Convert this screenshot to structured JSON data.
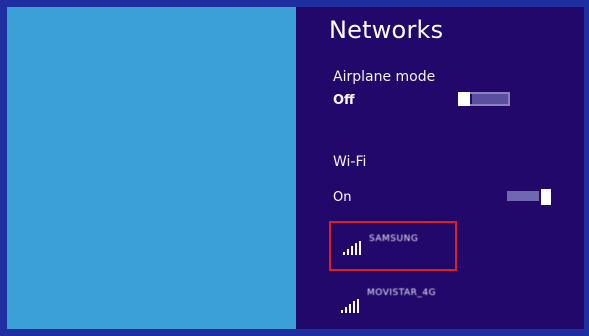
{
  "panel": {
    "title": "Networks",
    "airplane_mode": {
      "label": "Airplane mode",
      "state": "Off",
      "enabled": false
    },
    "wifi": {
      "label": "Wi-Fi",
      "state": "On",
      "enabled": true
    },
    "networks": [
      {
        "ssid": "SAMSUNG",
        "signal_bars": 5,
        "selected": true,
        "icon": "wifi-signal-icon"
      },
      {
        "ssid": "MOVISTAR_4G",
        "signal_bars": 5,
        "selected": false,
        "icon": "wifi-signal-icon"
      }
    ]
  },
  "colors": {
    "desktop": "#3b9fd8",
    "panel_background": "#22086a",
    "frame": "#1f2fa0",
    "selection_outline": "#e02020"
  }
}
